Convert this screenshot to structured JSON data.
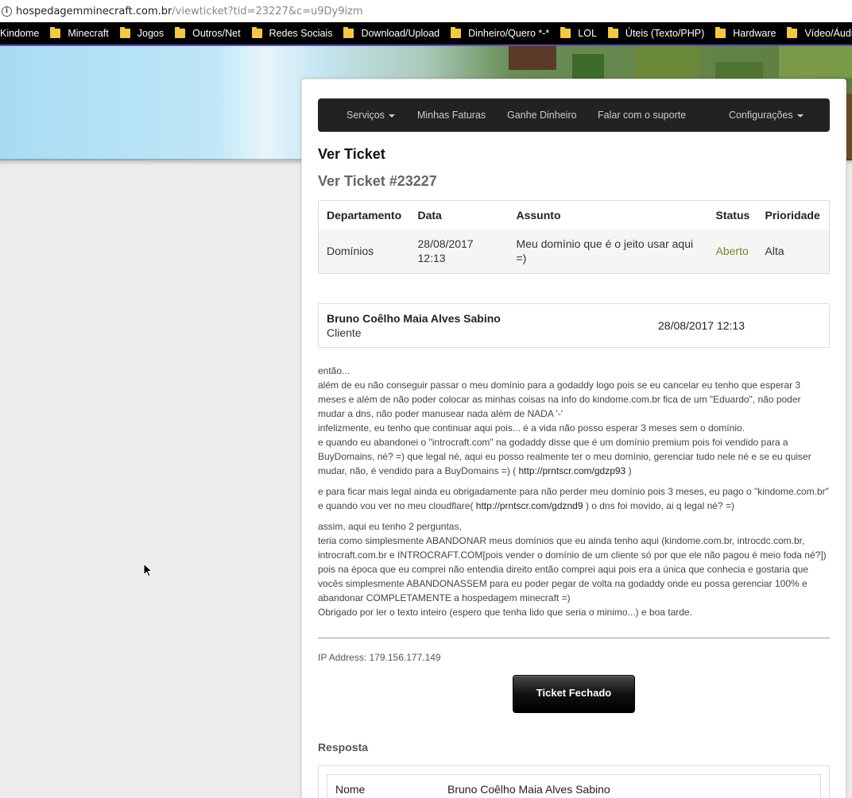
{
  "browser": {
    "url_domain": "hospedagemminecraft.com.br",
    "url_path": "/viewticket?tid=23227&c=u9Dy9izm"
  },
  "bookmarks": [
    "Kindome",
    "Minecraft",
    "Jogos",
    "Outros/Net",
    "Redes Sociais",
    "Download/Upload",
    "Dinheiro/Quero *-*",
    "LOL",
    "Úteis (Texto/PHP)",
    "Hardware",
    "Vídeo/Áudio"
  ],
  "nav": {
    "servicos": "Serviços",
    "faturas": "Minhas Faturas",
    "ganhe": "Ganhe Dinheiro",
    "suporte": "Falar com o suporte",
    "config": "Configurações"
  },
  "page": {
    "title": "Ver Ticket",
    "subtitle": "Ver Ticket #23227"
  },
  "ticket_table": {
    "headers": {
      "departamento": "Departamento",
      "data": "Data",
      "assunto": "Assunto",
      "status": "Status",
      "prioridade": "Prioridade"
    },
    "row": {
      "departamento": "Domínios",
      "data_date": "28/08/2017",
      "data_time": "12:13",
      "assunto_l1": "Meu domínio que é o jeito usar aqui",
      "assunto_l2": "=)",
      "status": "Aberto",
      "prioridade": "Alta"
    },
    "status_color": "#6b8e23"
  },
  "message": {
    "author": "Bruno Coêlho Maia Alves Sabino",
    "role": "Cliente",
    "date": "28/08/2017 12:13",
    "p1": [
      "então...",
      "além de eu não conseguir passar o meu domínio para a godaddy logo pois se eu cancelar eu tenho que esperar 3",
      "meses e além de não poder colocar as minhas coisas na info do kindome.com.br fica de um \"Eduardo\", não poder",
      "mudar a dns, não poder manusear nada além de NADA '-'",
      "infelizmente, eu tenho que continuar aqui pois... é a vida não posso esperar 3 meses sem o domínio.",
      "e quando eu abandonei o \"introcraft.com\" na godaddy disse que é um domínio premium pois foi vendido para a",
      "BuyDomains, né? =) que legal né, aqui eu posso realmente ter o meu domínio, gerenciar tudo nele né e se eu quiser"
    ],
    "p1_last_pre": "mudar, não, é vendido para a BuyDomains =) ( ",
    "p1_link": "http://prntscr.com/gdzp93",
    "p1_last_post": " )",
    "p2_l1": "e para ficar mais legal ainda eu obrigadamente para não perder meu domínio pois 3 meses, eu pago o \"kindome.com.br\"",
    "p2_l2_pre": "e quando vou ver no meu cloudflare( ",
    "p2_link": "http://prntscr.com/gdznd9",
    "p2_l2_post": " ) o dns foi movido, ai q legal né? =)",
    "p3": [
      "assim, aqui eu tenho 2 perguntas,",
      "teria como simplesmente ABANDONAR meus domínios que eu ainda tenho aqui (kindome.com.br, introcdc.com.br,",
      "introcraft.com.br e INTROCRAFT.COM[pois vender o domínio de um cliente só por que ele não pagou é meio foda né?])",
      "pois na época que eu comprei não entendia direito então comprei aqui pois era a única que conhecia e gostaria que",
      "vocês simplesmente ABANDONASSEM para eu poder pegar de volta na godaddy onde eu possa gerenciar 100% e",
      "abandonar COMPLETAMENTE a hospedagem minecraft =)",
      "Obrigado por ler o texto inteiro (espero que tenha lido que seria o minimo...) e boa tarde."
    ],
    "ip_label": "IP Address:",
    "ip_value": "179.156.177.149"
  },
  "closed_button": "Ticket Fechado",
  "response": {
    "title": "Resposta",
    "name_label": "Nome",
    "name_value": "Bruno Coêlho Maia Alves Sabino"
  }
}
